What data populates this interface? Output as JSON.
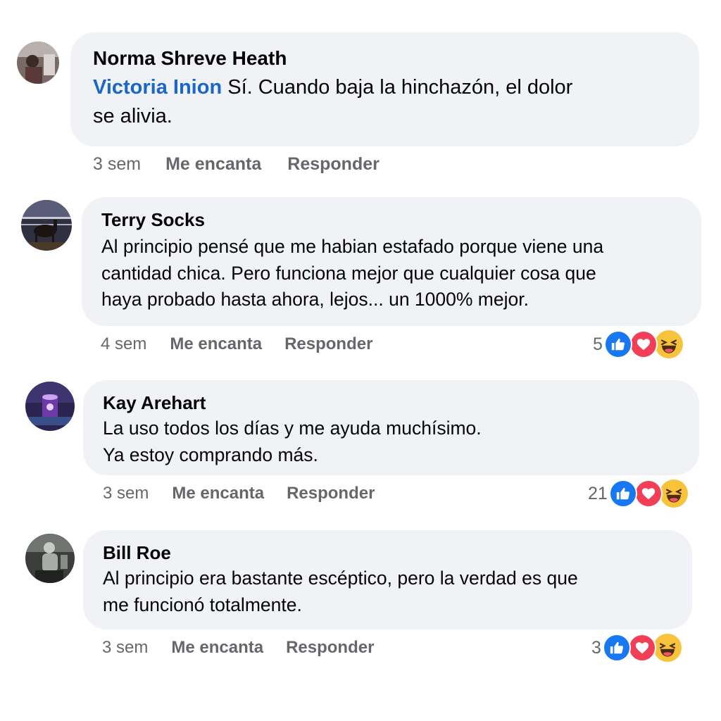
{
  "comments": [
    {
      "author": "Norma Shreve Heath",
      "mention": "Victoria Inion",
      "text_line1": " Sí. Cuando baja la hinchazón, el dolor",
      "text_line2": "se alivia.",
      "time": "3 sem",
      "like_label": "Me encanta",
      "reply_label": "Responder"
    },
    {
      "author": "Terry Socks",
      "text_line1": "Al principio pensé que me habian estafado porque viene una",
      "text_line2": "cantidad chica. Pero funciona mejor que cualquier cosa que",
      "text_line3": "haya probado hasta ahora, lejos... un 1000% mejor.",
      "time": "4 sem",
      "like_label": "Me encanta",
      "reply_label": "Responder",
      "reaction_count": "5",
      "reactions": [
        "like-icon",
        "love-icon",
        "haha-icon"
      ]
    },
    {
      "author": "Kay Arehart",
      "text_line1": "La uso todos los días y me ayuda muchísimo.",
      "text_line2": "Ya estoy comprando más.",
      "time": "3 sem",
      "like_label": "Me encanta",
      "reply_label": "Responder",
      "reaction_count": "21",
      "reactions": [
        "like-icon",
        "love-icon",
        "haha-icon"
      ]
    },
    {
      "author": "Bill Roe",
      "text_line1": "Al principio era bastante escéptico, pero la verdad es que",
      "text_line2": "me funcionó totalmente.",
      "time": "3 sem",
      "like_label": "Me encanta",
      "reply_label": "Responder",
      "reaction_count": "3",
      "reactions": [
        "like-icon",
        "love-icon",
        "haha-icon"
      ]
    }
  ],
  "colors": {
    "bubble": "#f0f2f5",
    "mention": "#1a66c9",
    "meta": "#65676b",
    "like": "#1877f2",
    "love": "#f33e58",
    "haha": "#f7c33b"
  }
}
